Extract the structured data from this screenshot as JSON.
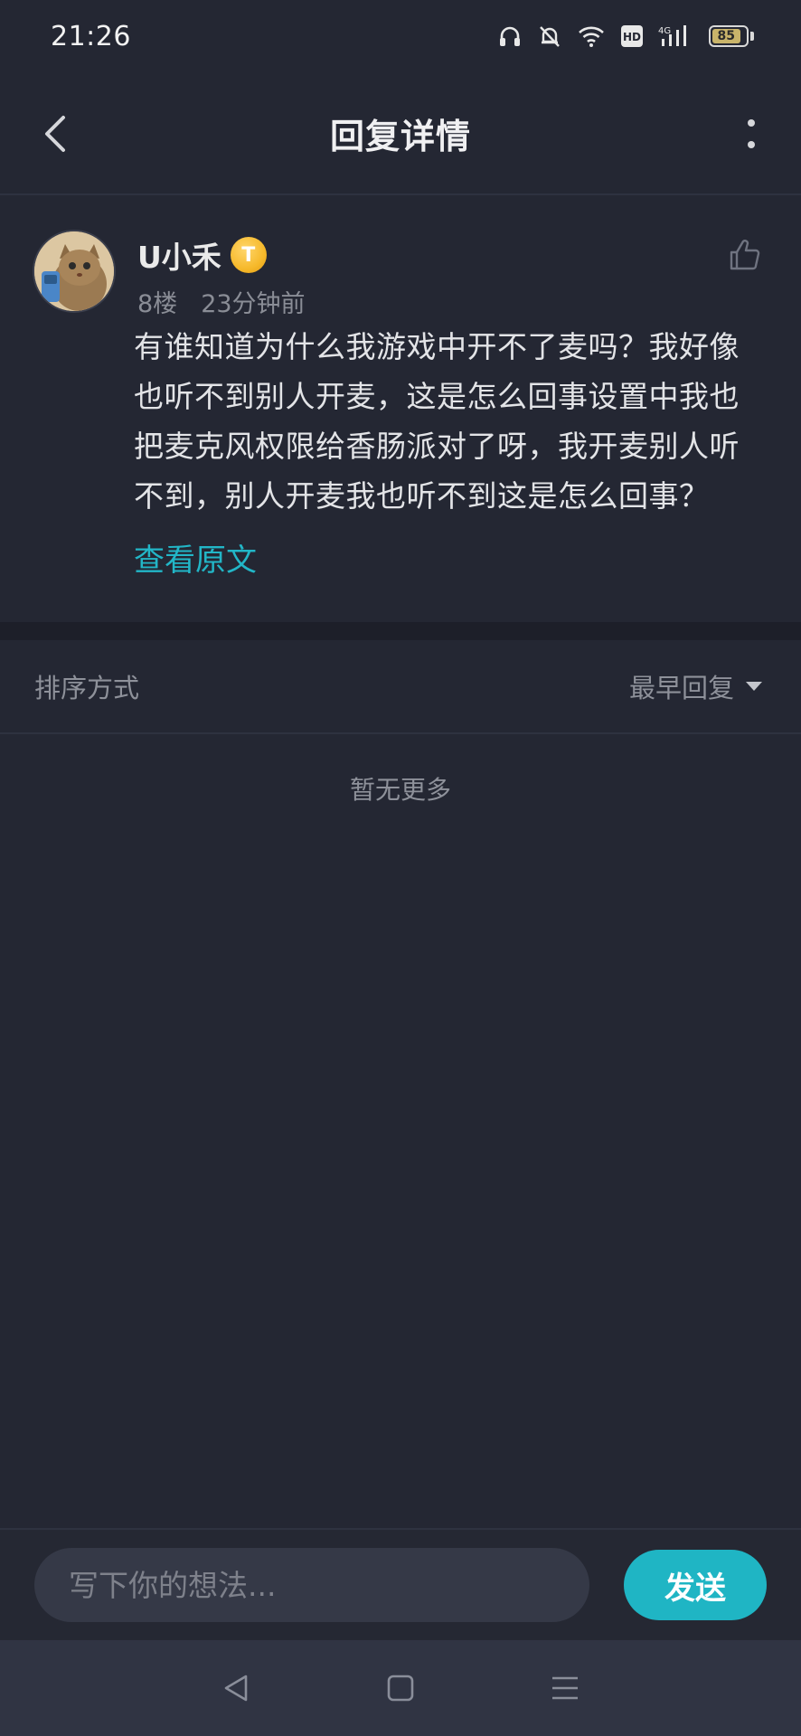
{
  "status_bar": {
    "time": "21:26",
    "network": "4G",
    "hd_label": "HD",
    "battery_level": "85"
  },
  "header": {
    "title": "回复详情",
    "back_icon": "chevron-left-icon",
    "more_icon": "vertical-ellipsis-icon"
  },
  "post": {
    "username": "U小禾",
    "level_badge": "T",
    "floor": "8楼",
    "time_ago": "23分钟前",
    "content": "有谁知道为什么我游戏中开不了麦吗？我好像也听不到别人开麦，这是怎么回事设置中我也把麦克风权限给香肠派对了呀，我开麦别人听不到，别人开麦我也听不到这是怎么回事？",
    "view_original": "查看原文",
    "like_icon": "thumbs-up-icon"
  },
  "sort": {
    "label": "排序方式",
    "selected": "最早回复"
  },
  "replies": {
    "empty_text": "暂无更多"
  },
  "composer": {
    "placeholder": "写下你的想法...",
    "send_label": "发送"
  },
  "nav": {
    "back_icon": "triangle-back-icon",
    "home_icon": "square-home-icon",
    "menu_icon": "hamburger-menu-icon"
  },
  "colors": {
    "background": "#242733",
    "accent": "#1fb5c4",
    "link": "#22b6c7",
    "muted_text": "#8e919a"
  }
}
